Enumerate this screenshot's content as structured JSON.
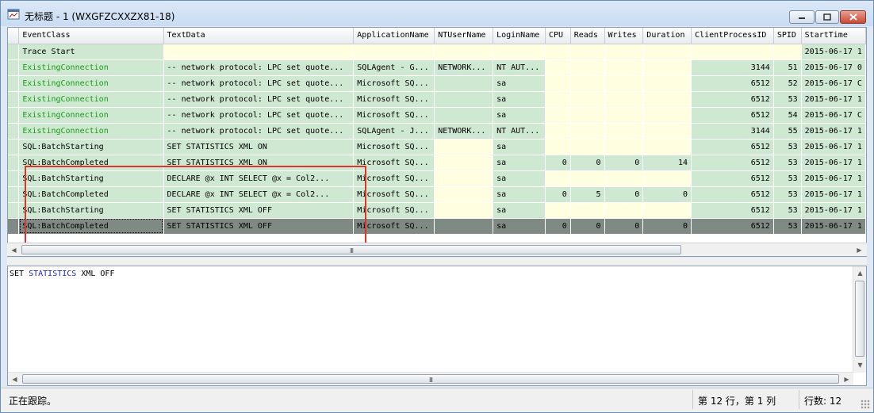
{
  "window": {
    "title": "无标题 - 1 (WXGFZCXXZX81-18)",
    "icon": "profiler-app-icon"
  },
  "columns": [
    "EventClass",
    "TextData",
    "ApplicationName",
    "NTUserName",
    "LoginName",
    "CPU",
    "Reads",
    "Writes",
    "Duration",
    "ClientProcessID",
    "SPID",
    "StartTime"
  ],
  "rows": [
    {
      "EventClass": "Trace Start",
      "TextData": "",
      "ApplicationName": "",
      "NTUserName": "",
      "LoginName": "",
      "CPU": "",
      "Reads": "",
      "Writes": "",
      "Duration": "",
      "ClientProcessID": "",
      "SPID": "",
      "StartTime": "2015-06-17 1"
    },
    {
      "EventClass": "ExistingConnection",
      "TextData": "-- network protocol: LPC  set quote...",
      "ApplicationName": "SQLAgent - G...",
      "NTUserName": "NETWORK...",
      "LoginName": "NT AUT...",
      "CPU": "",
      "Reads": "",
      "Writes": "",
      "Duration": "",
      "ClientProcessID": "3144",
      "SPID": "51",
      "StartTime": "2015-06-17 0"
    },
    {
      "EventClass": "ExistingConnection",
      "TextData": "-- network protocol: LPC  set quote...",
      "ApplicationName": "Microsoft SQ...",
      "NTUserName": "",
      "LoginName": "sa",
      "CPU": "",
      "Reads": "",
      "Writes": "",
      "Duration": "",
      "ClientProcessID": "6512",
      "SPID": "52",
      "StartTime": "2015-06-17 C"
    },
    {
      "EventClass": "ExistingConnection",
      "TextData": "-- network protocol: LPC  set quote...",
      "ApplicationName": "Microsoft SQ...",
      "NTUserName": "",
      "LoginName": "sa",
      "CPU": "",
      "Reads": "",
      "Writes": "",
      "Duration": "",
      "ClientProcessID": "6512",
      "SPID": "53",
      "StartTime": "2015-06-17 1"
    },
    {
      "EventClass": "ExistingConnection",
      "TextData": "-- network protocol: LPC  set quote...",
      "ApplicationName": "Microsoft SQ...",
      "NTUserName": "",
      "LoginName": "sa",
      "CPU": "",
      "Reads": "",
      "Writes": "",
      "Duration": "",
      "ClientProcessID": "6512",
      "SPID": "54",
      "StartTime": "2015-06-17 C"
    },
    {
      "EventClass": "ExistingConnection",
      "TextData": "-- network protocol: LPC  set quote...",
      "ApplicationName": "SQLAgent - J...",
      "NTUserName": "NETWORK...",
      "LoginName": "NT AUT...",
      "CPU": "",
      "Reads": "",
      "Writes": "",
      "Duration": "",
      "ClientProcessID": "3144",
      "SPID": "55",
      "StartTime": "2015-06-17 1"
    },
    {
      "EventClass": "SQL:BatchStarting",
      "TextData": "SET STATISTICS XML ON",
      "ApplicationName": "Microsoft SQ...",
      "NTUserName": "",
      "LoginName": "sa",
      "CPU": "",
      "Reads": "",
      "Writes": "",
      "Duration": "",
      "ClientProcessID": "6512",
      "SPID": "53",
      "StartTime": "2015-06-17 1"
    },
    {
      "EventClass": "SQL:BatchCompleted",
      "TextData": "SET STATISTICS XML ON",
      "ApplicationName": "Microsoft SQ...",
      "NTUserName": "",
      "LoginName": "sa",
      "CPU": "0",
      "Reads": "0",
      "Writes": "0",
      "Duration": "14",
      "ClientProcessID": "6512",
      "SPID": "53",
      "StartTime": "2015-06-17 1"
    },
    {
      "EventClass": "SQL:BatchStarting",
      "TextData": "DECLARE @x INT     SELECT @x = Col2...",
      "ApplicationName": "Microsoft SQ...",
      "NTUserName": "",
      "LoginName": "sa",
      "CPU": "",
      "Reads": "",
      "Writes": "",
      "Duration": "",
      "ClientProcessID": "6512",
      "SPID": "53",
      "StartTime": "2015-06-17 1"
    },
    {
      "EventClass": "SQL:BatchCompleted",
      "TextData": "DECLARE @x INT     SELECT @x = Col2...",
      "ApplicationName": "Microsoft SQ...",
      "NTUserName": "",
      "LoginName": "sa",
      "CPU": "0",
      "Reads": "5",
      "Writes": "0",
      "Duration": "0",
      "ClientProcessID": "6512",
      "SPID": "53",
      "StartTime": "2015-06-17 1"
    },
    {
      "EventClass": "SQL:BatchStarting",
      "TextData": "SET STATISTICS XML OFF",
      "ApplicationName": "Microsoft SQ...",
      "NTUserName": "",
      "LoginName": "sa",
      "CPU": "",
      "Reads": "",
      "Writes": "",
      "Duration": "",
      "ClientProcessID": "6512",
      "SPID": "53",
      "StartTime": "2015-06-17 1"
    },
    {
      "EventClass": "SQL:BatchCompleted",
      "TextData": "SET STATISTICS XML OFF",
      "ApplicationName": "Microsoft SQ...",
      "NTUserName": "",
      "LoginName": "sa",
      "CPU": "0",
      "Reads": "0",
      "Writes": "0",
      "Duration": "0",
      "ClientProcessID": "6512",
      "SPID": "53",
      "StartTime": "2015-06-17 1"
    }
  ],
  "selected_row": 11,
  "highlight_color": "#e0352a",
  "text_pane": {
    "sql_prefix": "SET ",
    "sql_keyword": "STATISTICS",
    "sql_suffix": " XML OFF"
  },
  "scrollbar": {
    "grip": "III"
  },
  "status": {
    "message": "正在跟踪。",
    "position": "第 12 行，第 1 列",
    "row_count": "行数: 12"
  }
}
